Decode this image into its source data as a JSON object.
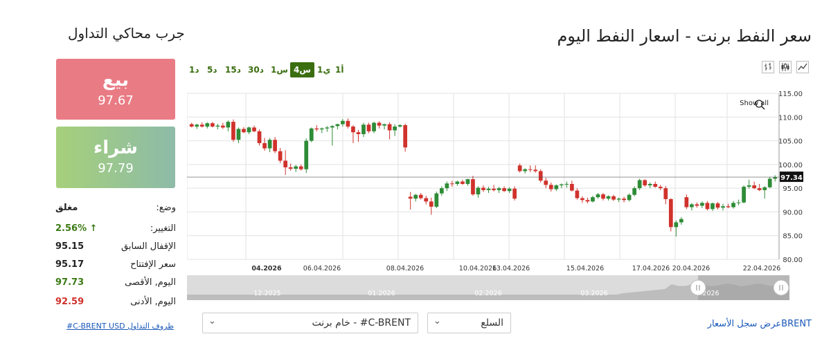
{
  "page": {
    "title": "سعر النفط برنت - اسعار النفط اليوم"
  },
  "timeframes": [
    {
      "label": "1أ"
    },
    {
      "label": "1ي"
    },
    {
      "label": "4س",
      "active": true
    },
    {
      "label": "1س"
    },
    {
      "label": "30د"
    },
    {
      "label": "15د"
    },
    {
      "label": "5د"
    },
    {
      "label": "1د"
    }
  ],
  "chart_type_icons": [
    "line-chart-icon",
    "candlestick-chart-icon",
    "ohlc-chart-icon"
  ],
  "trader": {
    "title": "جرب محاكي التداول",
    "sell_label": "بيع",
    "sell_price": "97.67",
    "buy_label": "شراء",
    "buy_price": "97.79"
  },
  "stats": [
    {
      "label": "وضع:",
      "value": "مغلق",
      "color": "#222"
    },
    {
      "label": "التغيير:",
      "value": "2.56%",
      "arrow": "↑",
      "color": "#3b7a14"
    },
    {
      "label": "الإقفال السابق",
      "value": "95.15",
      "color": "#222"
    },
    {
      "label": "سعر الإفتتاح",
      "value": "95.17",
      "color": "#222"
    },
    {
      "label": "اليوم, الأقصى",
      "value": "97.73",
      "color": "#3b7a14"
    },
    {
      "label": "اليوم, الأدنى",
      "value": "92.59",
      "color": "#d0322c"
    }
  ],
  "footer": {
    "conditions_link": "#C-BRENT USD ظروف التداول",
    "instrument_select": "C-BRENT# - خام برنت",
    "category_select": "السلع",
    "history_link": "BRENTعرض سجل الأسعار"
  },
  "colors": {
    "up": "#2e8b36",
    "down": "#d0322c",
    "accent": "#3b6e10"
  },
  "chart_data": {
    "type": "candlestick",
    "y_ticks": [
      "80.00",
      "85.00",
      "90.00",
      "95.00",
      "100.00",
      "105.00",
      "110.00",
      "115.00"
    ],
    "ylim": [
      80,
      115
    ],
    "x_labels": [
      "04.2026",
      "06.04.2026",
      "08.04.2026",
      "10.04.2026",
      "13.04.2026",
      "15.04.2026",
      "17.04.2026",
      "20.04.2026",
      "22.04.2026"
    ],
    "navigator_labels": [
      "12.2025",
      "01.2026",
      "02.2026",
      "03.2026",
      ".2026"
    ],
    "current_price": "97.34",
    "show_all": "Show all",
    "candles": [
      [
        108.5,
        108.8,
        107.8,
        108.0
      ],
      [
        108.0,
        108.6,
        107.5,
        108.4
      ],
      [
        108.4,
        108.9,
        107.8,
        108.0
      ],
      [
        108.0,
        108.9,
        107.6,
        108.7
      ],
      [
        108.7,
        109.0,
        107.8,
        108.0
      ],
      [
        108.0,
        108.6,
        107.4,
        108.2
      ],
      [
        108.2,
        108.8,
        107.5,
        107.8
      ],
      [
        107.8,
        109.3,
        107.0,
        109.0
      ],
      [
        109.0,
        109.5,
        104.8,
        105.2
      ],
      [
        105.2,
        107.8,
        104.5,
        107.5
      ],
      [
        107.5,
        107.9,
        106.6,
        106.8
      ],
      [
        106.8,
        108.0,
        106.4,
        107.8
      ],
      [
        107.8,
        108.2,
        106.8,
        107.0
      ],
      [
        107.0,
        107.4,
        104.0,
        104.5
      ],
      [
        104.5,
        105.6,
        102.9,
        103.4
      ],
      [
        103.4,
        105.6,
        102.6,
        105.2
      ],
      [
        105.2,
        105.8,
        102.4,
        102.8
      ],
      [
        102.8,
        103.5,
        100.3,
        100.8
      ],
      [
        100.8,
        103.0,
        97.8,
        99.4
      ],
      [
        99.4,
        100.2,
        98.7,
        99.1
      ],
      [
        99.1,
        99.9,
        98.4,
        99.6
      ],
      [
        99.6,
        100.0,
        98.7,
        99.0
      ],
      [
        99.0,
        105.5,
        98.2,
        105.0
      ],
      [
        105.0,
        107.8,
        104.7,
        107.6
      ],
      [
        107.6,
        108.3,
        107.0,
        107.4
      ],
      [
        107.4,
        107.8,
        106.6,
        107.6
      ],
      [
        107.6,
        108.1,
        106.9,
        107.8
      ],
      [
        107.8,
        108.3,
        104.0,
        108.1
      ],
      [
        108.1,
        108.6,
        107.4,
        108.5
      ],
      [
        108.5,
        109.6,
        108.0,
        109.2
      ],
      [
        109.2,
        109.7,
        107.6,
        108.0
      ],
      [
        108.0,
        108.3,
        104.5,
        106.8
      ],
      [
        106.8,
        107.3,
        104.8,
        106.4
      ],
      [
        106.4,
        108.8,
        105.8,
        108.4
      ],
      [
        108.4,
        108.8,
        106.6,
        107.0
      ],
      [
        107.0,
        109.0,
        106.6,
        108.8
      ],
      [
        108.8,
        109.1,
        107.6,
        108.2
      ],
      [
        108.2,
        108.6,
        107.4,
        108.5
      ],
      [
        108.5,
        108.9,
        105.3,
        107.2
      ],
      [
        107.2,
        108.5,
        106.0,
        108.0
      ],
      [
        108.0,
        108.5,
        107.8,
        108.3
      ],
      [
        108.3,
        108.6,
        102.7,
        103.6
      ],
      [
        93.2,
        94.2,
        90.5,
        92.8
      ],
      [
        92.8,
        93.8,
        92.2,
        93.6
      ],
      [
        93.6,
        94.0,
        92.6,
        92.9
      ],
      [
        92.9,
        93.4,
        91.6,
        92.2
      ],
      [
        92.2,
        93.0,
        89.4,
        91.1
      ],
      [
        91.1,
        94.3,
        90.8,
        93.9
      ],
      [
        93.9,
        95.4,
        93.4,
        95.0
      ],
      [
        95.0,
        96.4,
        94.4,
        96.0
      ],
      [
        96.0,
        96.6,
        95.3,
        95.9
      ],
      [
        95.9,
        96.6,
        95.5,
        96.4
      ],
      [
        96.4,
        96.8,
        95.7,
        95.9
      ],
      [
        95.9,
        97.0,
        95.5,
        96.9
      ],
      [
        96.9,
        97.6,
        93.4,
        93.7
      ],
      [
        93.7,
        95.4,
        93.0,
        95.1
      ],
      [
        95.1,
        95.6,
        94.2,
        94.6
      ],
      [
        94.6,
        95.3,
        94.0,
        94.9
      ],
      [
        94.9,
        95.7,
        94.3,
        94.6
      ],
      [
        94.6,
        95.3,
        94.0,
        95.0
      ],
      [
        95.0,
        95.4,
        94.2,
        94.4
      ],
      [
        94.4,
        95.2,
        94.0,
        94.9
      ],
      [
        94.9,
        95.4,
        92.4,
        92.8
      ],
      [
        99.8,
        100.2,
        98.3,
        98.6
      ],
      [
        98.6,
        99.2,
        98.1,
        99.0
      ],
      [
        99.0,
        99.8,
        98.4,
        98.9
      ],
      [
        98.9,
        99.8,
        98.3,
        98.6
      ],
      [
        98.6,
        99.0,
        96.2,
        96.6
      ],
      [
        96.6,
        97.2,
        95.0,
        95.7
      ],
      [
        95.7,
        96.2,
        94.3,
        94.8
      ],
      [
        94.8,
        95.8,
        94.4,
        95.6
      ],
      [
        95.6,
        96.0,
        95.0,
        95.8
      ],
      [
        95.8,
        96.4,
        95.1,
        95.9
      ],
      [
        95.9,
        96.6,
        94.3,
        94.5
      ],
      [
        94.5,
        95.0,
        92.6,
        92.9
      ],
      [
        92.9,
        93.3,
        91.9,
        92.5
      ],
      [
        92.5,
        93.0,
        91.8,
        92.2
      ],
      [
        92.2,
        93.4,
        92.0,
        93.1
      ],
      [
        93.1,
        94.0,
        92.8,
        93.7
      ],
      [
        93.7,
        94.0,
        92.4,
        92.8
      ],
      [
        92.8,
        93.5,
        92.4,
        93.3
      ],
      [
        93.3,
        93.6,
        92.3,
        92.6
      ],
      [
        92.6,
        93.0,
        92.1,
        92.8
      ],
      [
        92.8,
        93.2,
        92.0,
        92.5
      ],
      [
        92.5,
        93.9,
        92.2,
        93.6
      ],
      [
        93.6,
        95.4,
        93.3,
        95.0
      ],
      [
        95.0,
        97.0,
        94.6,
        96.7
      ],
      [
        96.7,
        96.9,
        95.3,
        95.6
      ],
      [
        95.6,
        96.2,
        95.0,
        95.9
      ],
      [
        95.9,
        96.4,
        95.1,
        95.3
      ],
      [
        95.3,
        95.7,
        94.6,
        95.0
      ],
      [
        95.0,
        95.5,
        91.6,
        92.7
      ],
      [
        92.7,
        92.9,
        85.9,
        86.8
      ],
      [
        86.8,
        88.2,
        84.8,
        87.8
      ],
      [
        87.8,
        88.9,
        87.3,
        88.5
      ],
      [
        93.1,
        93.7,
        90.6,
        91.0
      ],
      [
        91.0,
        91.9,
        90.3,
        91.6
      ],
      [
        91.6,
        92.0,
        90.9,
        91.3
      ],
      [
        91.3,
        92.2,
        90.8,
        91.9
      ],
      [
        91.9,
        92.3,
        90.3,
        90.6
      ],
      [
        90.6,
        92.0,
        90.2,
        91.8
      ],
      [
        91.8,
        92.1,
        90.5,
        90.9
      ],
      [
        90.9,
        91.7,
        90.3,
        91.2
      ],
      [
        91.2,
        91.7,
        90.8,
        91.0
      ],
      [
        91.0,
        92.3,
        90.7,
        91.9
      ],
      [
        91.9,
        92.6,
        91.4,
        92.0
      ],
      [
        92.0,
        95.6,
        91.8,
        95.3
      ],
      [
        95.3,
        96.8,
        94.9,
        95.6
      ],
      [
        95.6,
        96.4,
        94.8,
        95.0
      ],
      [
        95.0,
        95.9,
        94.4,
        94.6
      ],
      [
        94.6,
        95.4,
        92.8,
        95.2
      ],
      [
        95.2,
        97.4,
        95.0,
        97.0
      ],
      [
        97.0,
        97.73,
        96.4,
        97.34
      ]
    ]
  }
}
